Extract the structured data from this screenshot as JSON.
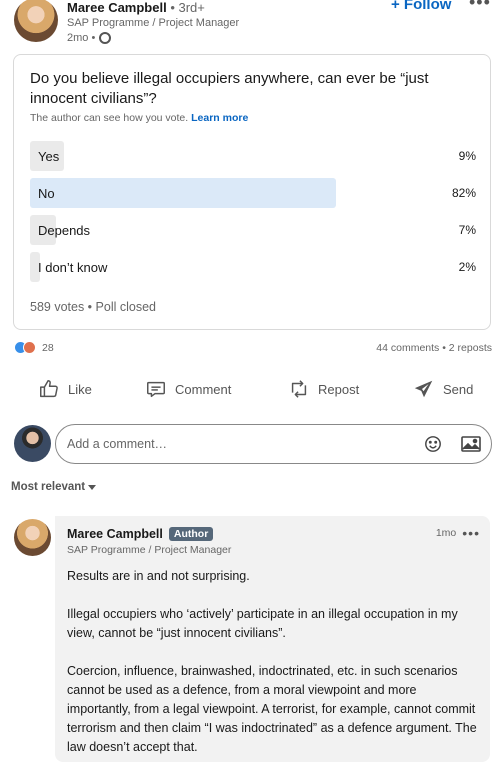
{
  "post": {
    "author_name": "Maree Campbell",
    "author_degree": " • 3rd+",
    "author_title": "SAP Programme / Project Manager",
    "time": "2mo •",
    "follow_label": "+ Follow",
    "more_label": "•••"
  },
  "poll": {
    "question": "Do you believe illegal occupiers anywhere, can ever be “just innocent civilians”?",
    "note": "The author can see how you vote.",
    "learn_more": "Learn more",
    "options": [
      {
        "label": "Yes",
        "percent": "9%",
        "value": 9,
        "selected": false
      },
      {
        "label": "No",
        "percent": "82%",
        "value": 82,
        "selected": true
      },
      {
        "label": "Depends",
        "percent": "7%",
        "value": 7,
        "selected": false
      },
      {
        "label": "I don’t know",
        "percent": "2%",
        "value": 2,
        "selected": false
      }
    ],
    "footer": "589 votes • Poll closed"
  },
  "social": {
    "reaction_count": "28",
    "stats": "44 comments • 2 reposts"
  },
  "actions": {
    "like": "Like",
    "comment": "Comment",
    "repost": "Repost",
    "send": "Send"
  },
  "add_comment": {
    "placeholder": "Add a comment…"
  },
  "sort": {
    "label": "Most relevant"
  },
  "comment": {
    "author_name": "Maree Campbell",
    "badge": "Author",
    "author_title": "SAP Programme / Project Manager",
    "time": "1mo",
    "more_label": "•••",
    "paragraphs": [
      "Results are in and not surprising.",
      "Illegal occupiers who ‘actively’ participate in an illegal occupation in my view, cannot be “just innocent civilians”.",
      "Coercion, influence, brainwashed, indoctrinated, etc. in such scenarios cannot be used as a defence, from a moral viewpoint and more importantly, from a legal viewpoint. A terrorist, for example, cannot commit terrorism and then claim “I was indoctrinated” as a defence argument. The law doesn’t accept that."
    ]
  },
  "colors": {
    "accent": "#0a66c2",
    "selected_bar": "#dbe9f8",
    "bar": "#eaeaea",
    "badge": "#56687a"
  }
}
